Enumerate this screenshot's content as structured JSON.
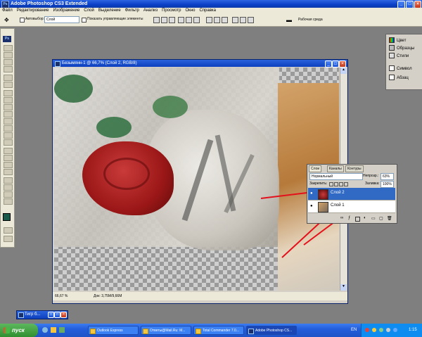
{
  "app": {
    "title": "Adobe Photoshop CS3 Extended",
    "icon": "ps-icon"
  },
  "menu": [
    "Файл",
    "Редактирование",
    "Изображение",
    "Слой",
    "Выделение",
    "Фильтр",
    "Анализ",
    "Просмотр",
    "Окно",
    "Справка"
  ],
  "options": {
    "autoselect_label": "Автовыбор:",
    "autoselect_value": "Слой",
    "show_controls": "Показать управляющие элементы",
    "workspace": "Рабочая среда"
  },
  "document": {
    "title": "Безымянн-1 @ 66,7% (Слой 2, RGB/8)",
    "zoom": "66,67 %",
    "doc_info": "Док: 3,75M/9,66M"
  },
  "right_panel": {
    "items": [
      "Цвет",
      "Образцы",
      "Стили",
      "Символ",
      "Абзац"
    ]
  },
  "layers_panel": {
    "tabs": [
      "Слои",
      "Каналы",
      "Контуры"
    ],
    "blend_mode": "Нормальный",
    "opacity_label": "Непрозр.:",
    "opacity_value": "63%",
    "lock_label": "Закрепить:",
    "fill_label": "Заливка:",
    "fill_value": "100%",
    "layers": [
      {
        "name": "Слой 2",
        "selected": true
      },
      {
        "name": "Слой 1",
        "selected": false
      }
    ]
  },
  "minimized": {
    "title": "Тигр б..."
  },
  "taskbar": {
    "start_label": "пуск",
    "tasks": [
      {
        "label": "Outlook Express",
        "active": false
      },
      {
        "label": "Ответы@Mail.Ru: М...",
        "active": false
      },
      {
        "label": "Total Commander 7.0...",
        "active": false
      },
      {
        "label": "Adobe Photoshop CS...",
        "active": true
      }
    ],
    "lang": "EN",
    "clock": "1:15"
  },
  "colors": {
    "xp_blue": "#245edb",
    "annotation": "#e3111b",
    "selection": "#316ac5",
    "rose": "#b31c1c"
  }
}
